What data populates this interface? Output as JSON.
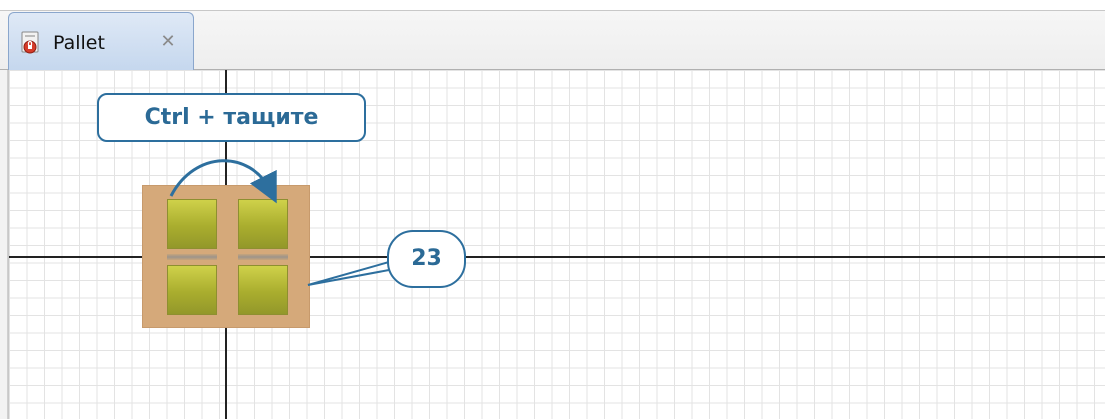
{
  "tab": {
    "icon": "pallet-lock-icon",
    "label": "Pallet",
    "close_icon": "close-icon",
    "close_glyph": "✕"
  },
  "canvas": {
    "grid": true,
    "background": "#ffffff",
    "grid_color": "#e3e3e3",
    "axis_color": "#222222"
  },
  "pallet": {
    "base_color": "#d5a97a",
    "box_color": "#b6b935",
    "box_count": 4
  },
  "callouts": {
    "ctrl_drag": "Ctrl + тащите",
    "box_count_label": "23",
    "accent": "#2d6f9e"
  }
}
